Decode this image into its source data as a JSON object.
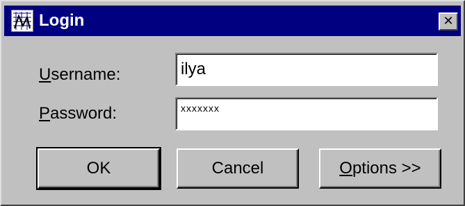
{
  "window": {
    "title": "Login",
    "close_glyph": "✕"
  },
  "form": {
    "username_label_accel": "U",
    "username_label_rest": "sername:",
    "username_value": "ilya",
    "password_label_accel": "P",
    "password_label_rest": "assword:",
    "password_value": "xxxxxxx"
  },
  "buttons": {
    "ok_label": "OK",
    "cancel_label": "Cancel",
    "options_accel": "O",
    "options_rest": "ptions >>"
  },
  "colors": {
    "titlebar": "#000080",
    "dialog_face": "#c0c0c0",
    "field_bg": "#ffffff"
  },
  "icons": {
    "app": "app-icon",
    "close": "close-icon"
  }
}
